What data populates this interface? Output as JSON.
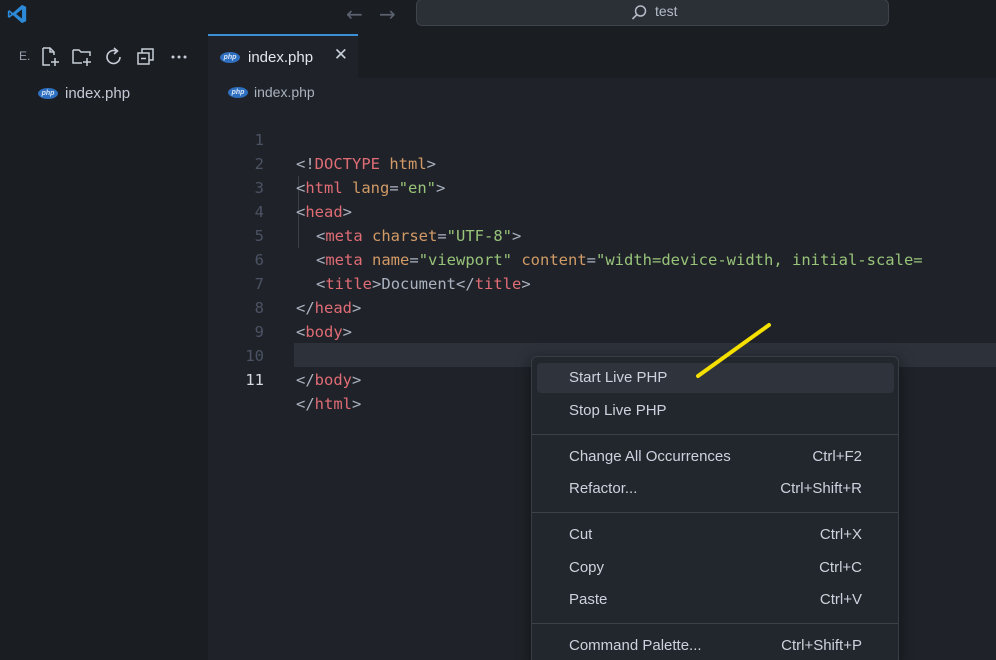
{
  "titlebar": {
    "search_text": "test",
    "icons": [
      "vscode-logo-icon",
      "arrow-left-icon",
      "arrow-right-icon",
      "search-icon"
    ]
  },
  "sidebar": {
    "title": "E.",
    "actions": [
      "new-file-icon",
      "new-folder-icon",
      "refresh-icon",
      "collapse-all-icon",
      "more-icon"
    ],
    "files": [
      {
        "name": "index.php",
        "icon": "php-file-icon"
      }
    ]
  },
  "tabs": [
    {
      "name": "index.php",
      "icon": "php-file-icon",
      "close": "✕"
    }
  ],
  "breadcrumb": {
    "file": "index.php"
  },
  "php_badge": "php",
  "editor": {
    "lines": [
      {
        "n": "1"
      },
      {
        "n": "2"
      },
      {
        "n": "3"
      },
      {
        "n": "4"
      },
      {
        "n": "5"
      },
      {
        "n": "6"
      },
      {
        "n": "7"
      },
      {
        "n": "8"
      },
      {
        "n": "9"
      },
      {
        "n": "10"
      },
      {
        "n": "11"
      }
    ],
    "active_line": "11",
    "tokens": {
      "l1": [
        "<!",
        "DOCTYPE",
        " html",
        ">"
      ],
      "l2": [
        "<",
        "html",
        " lang",
        "=",
        "\"en\"",
        ">"
      ],
      "l3": [
        "<",
        "head",
        ">"
      ],
      "l4": [
        "<",
        "meta",
        " charset",
        "=",
        "\"UTF-8\"",
        ">"
      ],
      "l5": [
        "<",
        "meta",
        " name",
        "=",
        "\"viewport\"",
        " content",
        "=",
        "\"width=device-width, initial-scale="
      ],
      "l6": [
        "<",
        "title",
        ">",
        "Document",
        "</",
        "title",
        ">"
      ],
      "l7": [
        "</",
        "head",
        ">"
      ],
      "l8": [
        "<",
        "body",
        ">"
      ],
      "l10": [
        "</",
        "body",
        ">"
      ],
      "l11": [
        "</",
        "html",
        ">"
      ]
    }
  },
  "context_menu": {
    "items": [
      {
        "label": "Start Live PHP",
        "shortcut": "",
        "hovered": true
      },
      {
        "label": "Stop Live PHP",
        "shortcut": ""
      },
      {
        "label": "Change All Occurrences",
        "shortcut": "Ctrl+F2"
      },
      {
        "label": "Refactor...",
        "shortcut": "Ctrl+Shift+R"
      },
      {
        "label": "Cut",
        "shortcut": "Ctrl+X"
      },
      {
        "label": "Copy",
        "shortcut": "Ctrl+C"
      },
      {
        "label": "Paste",
        "shortcut": "Ctrl+V"
      },
      {
        "label": "Command Palette...",
        "shortcut": "Ctrl+Shift+P"
      }
    ]
  },
  "colors": {
    "accent": "#3c8fd6",
    "tag": "#e06c75",
    "attribute": "#d19a66",
    "string": "#98c379",
    "annotation_highlight": "#f5e000"
  }
}
